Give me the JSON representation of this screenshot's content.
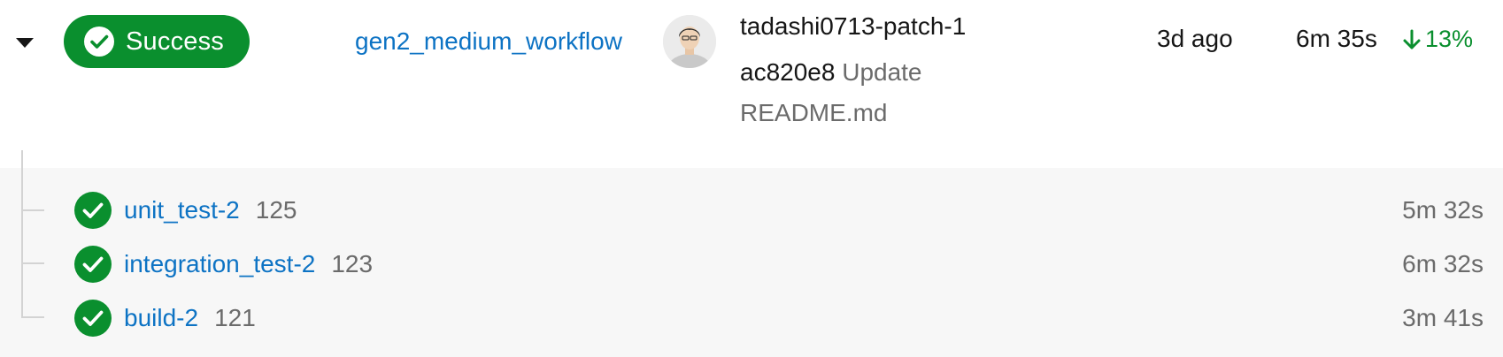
{
  "pipeline": {
    "status_label": "Success",
    "workflow_name": "gen2_medium_workflow",
    "branch": "tadashi0713-patch-1",
    "commit_hash": "ac820e8",
    "commit_message": "Update README.md",
    "time_ago": "3d ago",
    "duration": "6m 35s",
    "duration_change": "13%"
  },
  "jobs": [
    {
      "name": "unit_test-2",
      "number": "125",
      "duration": "5m 32s"
    },
    {
      "name": "integration_test-2",
      "number": "123",
      "duration": "6m 32s"
    },
    {
      "name": "build-2",
      "number": "121",
      "duration": "3m 41s"
    }
  ],
  "icons": {
    "expand": "caret-down-icon",
    "status": "check-circle-icon",
    "trend": "arrow-down-icon",
    "avatar": "user-avatar"
  },
  "colors": {
    "success": "#0a8f2e",
    "link": "#0d73c4",
    "muted": "#6b6b6b",
    "panel_bg": "#f7f7f7"
  }
}
